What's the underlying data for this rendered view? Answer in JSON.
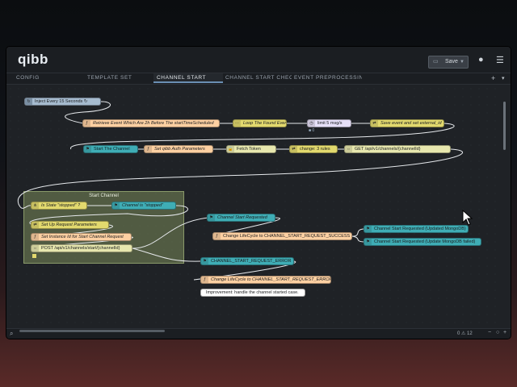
{
  "app": {
    "logo": "qibb"
  },
  "header": {
    "deploy_label": "Save",
    "deploy_icon": "save-icon",
    "user_icon": "user-icon",
    "menu_icon": "menu-icon"
  },
  "tabs": [
    {
      "label": "CONFIG",
      "active": false
    },
    {
      "label": "TEMPLATE SET",
      "active": false
    },
    {
      "label": "CHANNEL START",
      "active": true
    },
    {
      "label": "CHANNEL START CHECK",
      "active": false
    },
    {
      "label": "EVENT PREPROCESSING",
      "active": false
    }
  ],
  "tab_actions": {
    "add": "+",
    "more": "▾"
  },
  "group": {
    "label": "Start Channel"
  },
  "nodes": {
    "inject": "Inject Every 15 Seconds ↻",
    "retrieve": "Retrieve Event Which Are 2h Before The startTimeScheduled",
    "loop": "Loop The Found Events",
    "limit": "limit 5 msg/s",
    "save_event": "Save event and set external_id",
    "start_the_channel": "Start The Channel",
    "set_auth": "Set qibb Auth Parameters",
    "fetch_token": "Fetch Token",
    "change_rules": "change: 3 rules",
    "get_channel": "GET /api/v1/channels/{channelId}",
    "is_state": "Is State \"stopped\" ?",
    "channel_stopped": "Channel is \"stopped\"",
    "set_up_request": "Set Up Request Parameters",
    "set_instance": "Set Instance Id for Start Channel Request",
    "post_start": "POST /api/v1/channels/start/{channelId}",
    "channel_start_requested": "Channel Start Requested",
    "change_lifecycle_success": "Change LifeCycle to CHANNEL_START_REQUEST_SUCCESS",
    "requested_updated": "Channel Start Requested (Updated MongoDB)",
    "requested_update_failed": "Channel Start Requested (Update MongoDB failed)",
    "start_request_error": "CHANNEL_START_REQUEST_ERROR",
    "change_lifecycle_error": "Change LifeCycle to CHANNEL_START_REQUEST_ERROR",
    "comment": "Improvement: handle the channel started case."
  },
  "badges": {
    "limit_count": "0"
  },
  "footer": {
    "status": "0 ⚠ 12",
    "zoom_out": "−",
    "zoom_reset": "○",
    "zoom_in": "+"
  },
  "colors": {
    "inject": "#a6bbcf",
    "function": "#fdd0a2",
    "split": "#e2d96e",
    "delay": "#e6e0f8",
    "change": "#e2d96e",
    "link": "#3fadb5",
    "http": "#e7e7ae",
    "comment": "#ffffff",
    "group": "#7a8a5a",
    "workspace": "#1f2226"
  }
}
